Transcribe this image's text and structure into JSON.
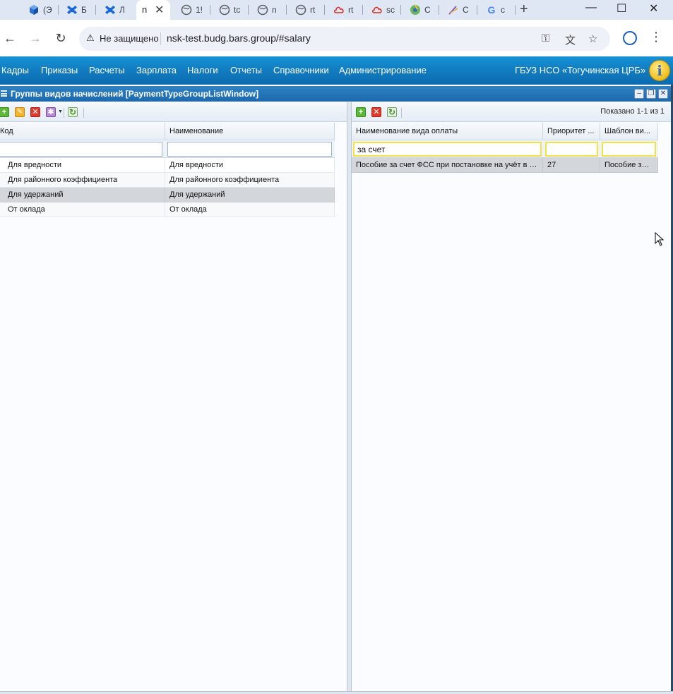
{
  "browser": {
    "tabs": [
      {
        "label": "(Э",
        "icon": "cube-icon",
        "color": "#1a73e8"
      },
      {
        "label": "Б",
        "icon": "confluence-icon",
        "color": "#1868db"
      },
      {
        "label": "Л",
        "icon": "confluence-icon",
        "color": "#1868db"
      },
      {
        "label": "n",
        "active": true
      },
      {
        "label": "1!",
        "icon": "globe-icon"
      },
      {
        "label": "tc",
        "icon": "globe-icon"
      },
      {
        "label": "n",
        "icon": "globe-icon"
      },
      {
        "label": "rt",
        "icon": "globe-icon"
      },
      {
        "label": "rt",
        "icon": "cloud-icon",
        "color": "#d93025"
      },
      {
        "label": "sc",
        "icon": "cloud-icon",
        "color": "#d93025"
      },
      {
        "label": "C",
        "icon": "chromium-icon",
        "color": "#3d8f3d"
      },
      {
        "label": "C",
        "icon": "pen-icon",
        "color": "#8a56c2"
      },
      {
        "label": "c",
        "icon": "google-icon",
        "color": "#4285f4"
      }
    ],
    "security_label": "Не защищено",
    "url": "nsk-test.budg.bars.group/#salary"
  },
  "menu": {
    "items": [
      "Кадры",
      "Приказы",
      "Расчеты",
      "Зарплата",
      "Налоги",
      "Отчеты",
      "Справочники",
      "Администрирование"
    ],
    "organization": "ГБУЗ НСО «Тогучинская ЦРБ»",
    "info_icon_glyph": "i"
  },
  "window": {
    "title": "Группы видов начислений [PaymentTypeGroupListWindow]"
  },
  "left_grid": {
    "columns": [
      "Код",
      "Наименование"
    ],
    "filters": [
      "",
      ""
    ],
    "rows": [
      [
        "Для вредности",
        "Для вредности"
      ],
      [
        "Для районного коэффициента",
        "Для районного коэффициента"
      ],
      [
        "Для удержаний",
        "Для удержаний"
      ],
      [
        "От оклада",
        "От оклада"
      ]
    ],
    "selected_row": 2
  },
  "right_grid": {
    "paging": "Показано 1-1 из 1",
    "columns": [
      "Наименование вида оплаты",
      "Приоритет ...",
      "Шаблон ви..."
    ],
    "filters": [
      "за счет",
      "",
      ""
    ],
    "rows": [
      [
        "Пособие за счет ФСС при постановке на учёт в р...",
        "27",
        "Пособие за ..."
      ]
    ],
    "selected_row": 0
  },
  "colors": {
    "menubar": "#1179bd",
    "title_bar": "#1c68ad",
    "selected_row": "#d3d6da",
    "filter_highlight": "#f2e24a"
  }
}
